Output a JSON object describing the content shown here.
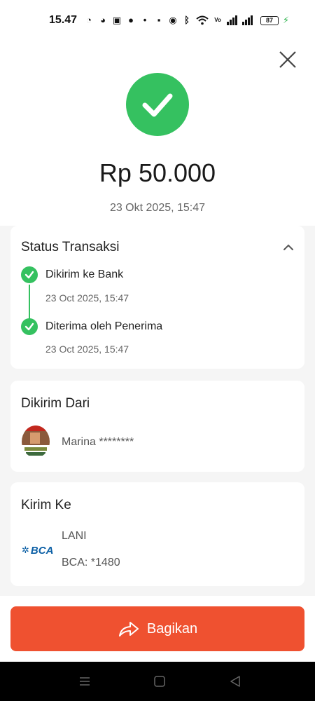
{
  "status_bar": {
    "time": "15.47",
    "icons": [
      "whatsapp-icon",
      "whatsapp-business-icon",
      "chat-icon",
      "facebook-icon",
      "dot-icon",
      "nfc-icon",
      "alarm-icon",
      "bluetooth-icon",
      "wifi-icon",
      "volte-icon",
      "signal-icon",
      "signal-icon"
    ],
    "battery": "87"
  },
  "header": {
    "amount": "Rp 50.000",
    "date": "23 Okt 2025, 15:47"
  },
  "status_card": {
    "title": "Status Transaksi",
    "steps": [
      {
        "label": "Dikirim ke Bank",
        "time": "23 Oct 2025, 15:47"
      },
      {
        "label": "Diterima oleh Penerima",
        "time": "23 Oct 2025, 15:47"
      }
    ]
  },
  "from_card": {
    "title": "Dikirim Dari",
    "sender_name": "Marina ********"
  },
  "to_card": {
    "title": "Kirim Ke",
    "bank_logo_text": "BCA",
    "recipient_name": "LANI",
    "account": "BCA: *1480"
  },
  "actions": {
    "share_label": "Bagikan"
  },
  "colors": {
    "success": "#35c160",
    "accent": "#ef5130",
    "bank_blue": "#0b5fa5"
  }
}
